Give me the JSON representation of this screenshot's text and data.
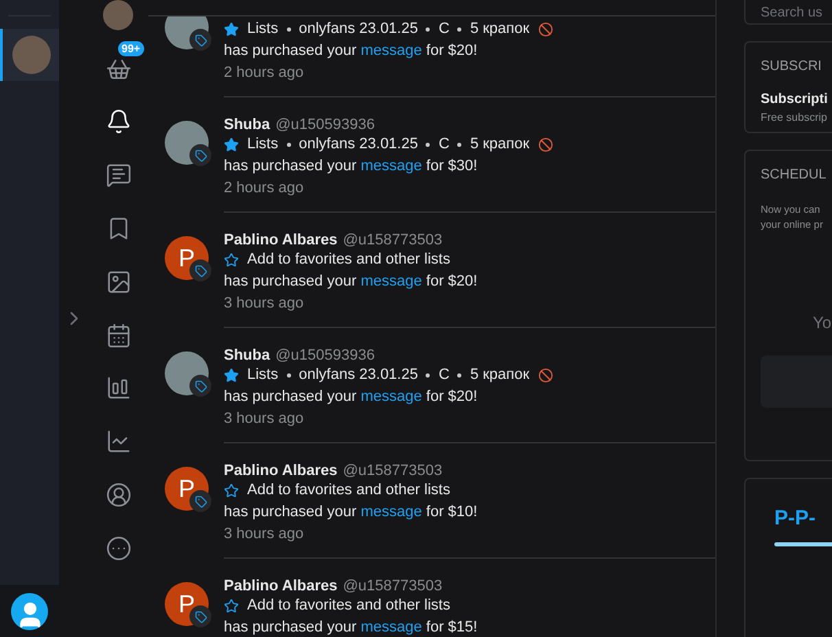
{
  "accounts": [
    {
      "selected": true
    }
  ],
  "nav": [
    {
      "selected": false
    },
    {
      "selected": false,
      "badge": "99+"
    },
    {
      "selected": true
    },
    {
      "selected": false
    },
    {
      "selected": false
    },
    {
      "selected": false
    },
    {
      "selected": false
    },
    {
      "selected": false
    },
    {
      "selected": false
    },
    {
      "selected": false
    },
    {
      "selected": false
    }
  ],
  "feed": [
    {
      "kind": "photo",
      "starred": true,
      "tags": [
        "Lists",
        "onlyfans 23.01.25",
        "C",
        "5 крапок"
      ],
      "message": {
        "before": "has purchased your",
        "link": "message",
        "after": "for $20!"
      },
      "time": "2 hours ago"
    },
    {
      "kind": "photo",
      "name": "Shuba",
      "handle": "@u150593936",
      "starred": true,
      "tags": [
        "Lists",
        "onlyfans 23.01.25",
        "C",
        "5 крапок"
      ],
      "message": {
        "before": "has purchased your",
        "link": "message",
        "after": "for $30!"
      },
      "time": "2 hours ago"
    },
    {
      "kind": "letter",
      "initial": "P",
      "name": "Pablino Albares",
      "handle": "@u158773503",
      "starred": false,
      "tags": [
        "Add to favorites and other lists"
      ],
      "message": {
        "before": "has purchased your",
        "link": "message",
        "after": "for $20!"
      },
      "time": "3 hours ago"
    },
    {
      "kind": "photo",
      "name": "Shuba",
      "handle": "@u150593936",
      "starred": true,
      "tags": [
        "Lists",
        "onlyfans 23.01.25",
        "C",
        "5 крапок"
      ],
      "message": {
        "before": "has purchased your",
        "link": "message",
        "after": "for $20!"
      },
      "time": "3 hours ago"
    },
    {
      "kind": "letter",
      "initial": "P",
      "name": "Pablino Albares",
      "handle": "@u158773503",
      "starred": false,
      "tags": [
        "Add to favorites and other lists"
      ],
      "message": {
        "before": "has purchased your",
        "link": "message",
        "after": "for $10!"
      },
      "time": "3 hours ago"
    },
    {
      "kind": "letter",
      "initial": "P",
      "name": "Pablino Albares",
      "handle": "@u158773503",
      "starred": false,
      "tags": [
        "Add to favorites and other lists"
      ],
      "message": {
        "before": "has purchased your",
        "link": "message",
        "after": "for $15!"
      }
    }
  ],
  "right": {
    "search": {
      "placeholder": "Search us"
    },
    "subscription": {
      "heading": "SUBSCRI",
      "title": "Subscripti",
      "subtitle": "Free subscrip"
    },
    "schedule": {
      "heading": "SCHEDUL",
      "text": "Now you can your online pr",
      "empty": "Yo"
    },
    "ppv": {
      "title": "P-P-"
    }
  }
}
